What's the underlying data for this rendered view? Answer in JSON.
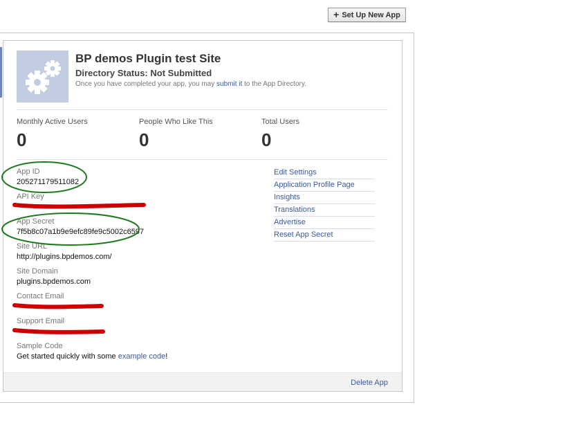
{
  "toolbar": {
    "setup_label": "Set Up New App"
  },
  "app": {
    "title": "BP demos Plugin test Site",
    "directory_status": "Directory Status: Not Submitted",
    "note_before": "Once you have completed your app, you may ",
    "note_link": "submit it",
    "note_after": " to the App Directory."
  },
  "stats": [
    {
      "label": "Monthly Active Users",
      "value": "0"
    },
    {
      "label": "People Who Like This",
      "value": "0"
    },
    {
      "label": "Total Users",
      "value": "0"
    }
  ],
  "fields": {
    "app_id": {
      "label": "App ID",
      "value": "205271179511082"
    },
    "api_key": {
      "label": "API Key",
      "value": ""
    },
    "app_secret": {
      "label": "App Secret",
      "value": "7f5b8c07a1b9e9efc89fe9c5002c6597"
    },
    "site_url": {
      "label": "Site URL",
      "value": "http://plugins.bpdemos.com/"
    },
    "site_domain": {
      "label": "Site Domain",
      "value": "plugins.bpdemos.com"
    },
    "contact_email": {
      "label": "Contact Email",
      "value": ""
    },
    "support_email": {
      "label": "Support Email",
      "value": ""
    },
    "sample_code": {
      "label": "Sample Code",
      "text_before": "Get started quickly with some ",
      "link": "example code",
      "text_after": "!"
    }
  },
  "actions": [
    "Edit Settings",
    "Application Profile Page",
    "Insights",
    "Translations",
    "Advertise",
    "Reset App Secret"
  ],
  "footer": {
    "delete_label": "Delete App"
  },
  "colors": {
    "link": "#3b5998",
    "annotation_circle": "#1f7a1f",
    "redaction": "#cc0000",
    "icon_bg": "#c3cde2"
  },
  "icons": {
    "app_icon": "gears-icon",
    "setup_icon": "plus-icon"
  }
}
